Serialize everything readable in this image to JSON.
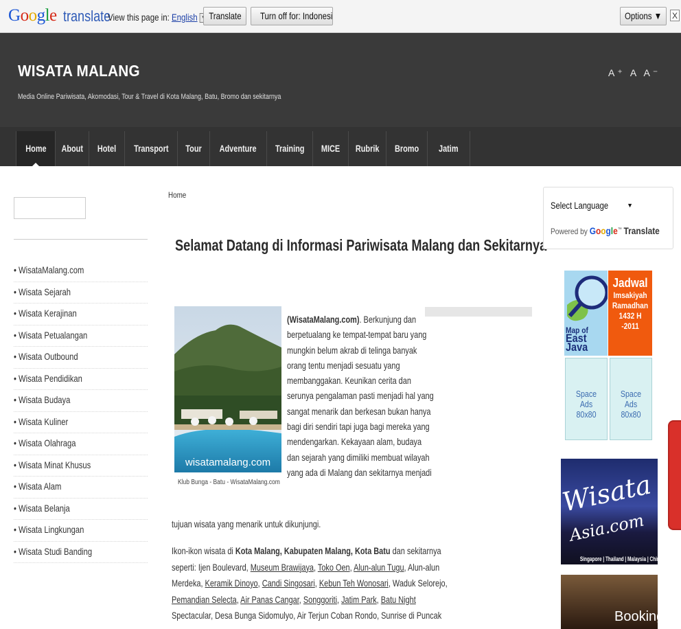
{
  "gtranslate": {
    "logo": "Google",
    "product": "translate",
    "view_label": "View this page in:",
    "language_link": "English",
    "translate_btn": "Translate",
    "turnoff_btn": "Turn off for: Indonesian",
    "options_btn": "Options ▼",
    "close_btn": "X"
  },
  "site": {
    "title": "WISATA MALANG",
    "description": "Media Online Pariwisata, Akomodasi, Tour & Travel di Kota Malang, Batu, Bromo dan sekitarnya",
    "font_sizer": "A⁺ A A⁻"
  },
  "nav": [
    {
      "label": "Home",
      "active": true
    },
    {
      "label": "About"
    },
    {
      "label": "Hotel"
    },
    {
      "label": "Transport"
    },
    {
      "label": "Tour"
    },
    {
      "label": "Adventure"
    },
    {
      "label": "Training"
    },
    {
      "label": "MICE"
    },
    {
      "label": "Rubrik"
    },
    {
      "label": "Bromo"
    },
    {
      "label": "Jatim"
    }
  ],
  "sidebar": {
    "categories": [
      "WisataMalang.com",
      "Wisata Sejarah",
      "Wisata Kerajinan",
      "Wisata Petualangan",
      "Wisata Outbound",
      "Wisata Pendidikan",
      "Wisata Budaya",
      "Wisata Kuliner",
      "Wisata Olahraga",
      "Wisata Minat Khusus",
      "Wisata Alam",
      "Wisata Belanja",
      "Wisata Lingkungan",
      "Wisata Studi Banding"
    ]
  },
  "main": {
    "breadcrumb": "Home",
    "title": "Selamat Datang di Informasi Pariwisata Malang dan Sekitarnya",
    "image_watermark": "wisatamalang.com",
    "image_caption": "Klub Bunga - Batu - WisataMalang.com",
    "intro_bold": "(WisataMalang.com)",
    "intro_first_rest": ". Berkunjung dan",
    "intro_lines": [
      "berpetualang ke tempat-tempat baru yang",
      "mungkin belum akrab di telinga banyak",
      "orang tentu menjadi sesuatu yang",
      "membanggakan. Keunikan cerita dan",
      "serunya pengalaman pasti menjadi hal yang",
      "sangat menarik dan berkesan bukan hanya",
      "bagi diri sendiri tapi juga bagi mereka yang",
      "mendengarkan. Kekayaan alam, budaya",
      "dan sejarah yang dimiliki membuat wilayah",
      "yang ada di Malang dan sekitarnya menjadi"
    ],
    "continue_line": "tujuan wisata yang menarik untuk dikunjungi.",
    "para2": {
      "l1_a": "Ikon-ikon wisata di ",
      "l1_b": "Kota Malang, Kabupaten Malang, Kota Batu",
      "l1_c": " dan sekitarnya",
      "l2_a": "seperti: Ijen Boulevard, ",
      "l2_link1": "Museum Brawijaya",
      "l2_b": ", ",
      "l2_link2": "Toko Oen",
      "l2_c": ", ",
      "l2_link3": "Alun-alun Tugu",
      "l2_d": ", Alun-alun",
      "l3_a": "Merdeka, ",
      "l3_link1": "Keramik Dinoyo",
      "l3_b": ", ",
      "l3_link2": "Candi Singosari",
      "l3_c": ", ",
      "l3_link3": "Kebun Teh Wonosari",
      "l3_d": ", Waduk Selorejo,",
      "l4_link1": "Pemandian Selecta",
      "l4_a": ", ",
      "l4_link2": "Air Panas Cangar",
      "l4_b": ", ",
      "l4_link3": "Songgoriti",
      "l4_c": ", ",
      "l4_link4": "Jatim Park",
      "l4_d": ", ",
      "l4_link5": "Batu Night",
      "l5": "Spectacular, Desa Bunga Sidomulyo, Air Terjun Coban Rondo, Sunrise di Puncak"
    }
  },
  "right": {
    "lang_select": "Select Language",
    "powered_by": "Powered by",
    "google": "Google",
    "tm": "™",
    "translate": "Translate",
    "ad_map_of": "Map of",
    "ad_east_java": "East Java",
    "ad_jadwal": "Jadwal",
    "ad_imsakiyah": "Imsakiyah",
    "ad_ramadhan": "Ramadhan",
    "ad_year": "1432 H -2011",
    "space_ad_1": "Space Ads 80x80",
    "space_ad_2": "Space Ads 80x80",
    "asia_title_main": "Wisata",
    "asia_title_sub": "Asia.com",
    "asia_countries": "Singapore | Thailand | Malaysia | China | Korea",
    "hotel_ad_text": "Booking"
  },
  "colors": {
    "header_bg": "#3a3a3a",
    "nav_bg": "#333333",
    "jadwal_orange": "#f05a0e",
    "space_ads_bg": "#d9f1f2",
    "side_tab_red": "#d9302a"
  }
}
